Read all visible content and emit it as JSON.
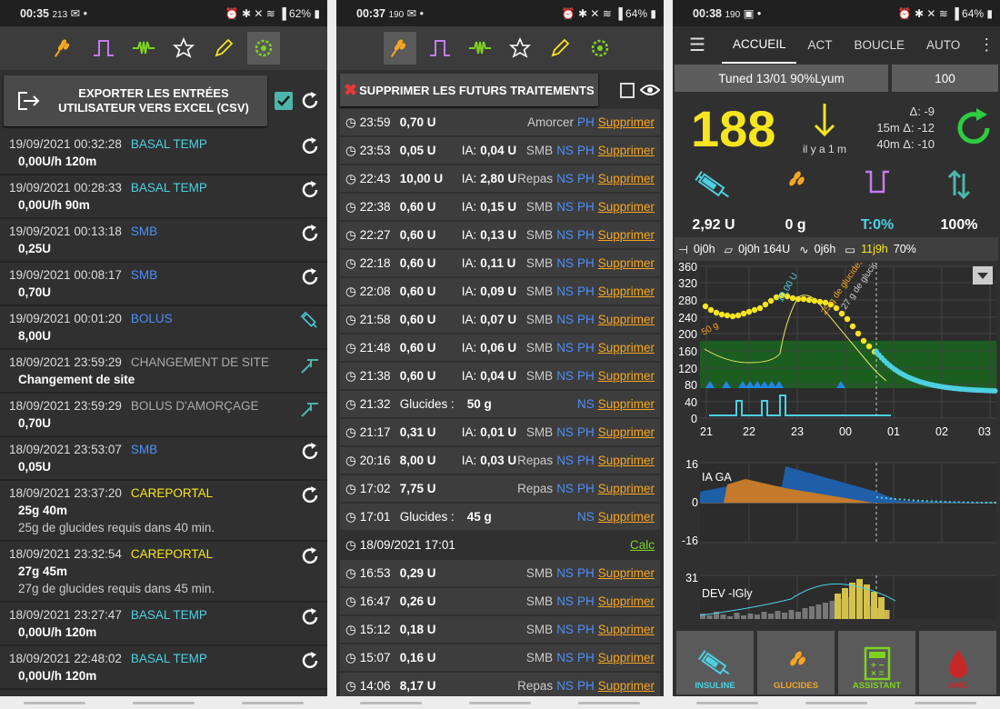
{
  "panel1": {
    "status": {
      "time": "00:35",
      "icons_left": "213",
      "battery": "62%"
    },
    "export_label": "EXPORTER LES ENTRÉES UTILISATEUR VERS EXCEL (CSV)",
    "entries": [
      {
        "date": "19/09/2021 00:32:28",
        "type": "BASAL TEMP",
        "type_color": "#4dd0e1",
        "value": "0,00U/h  120m",
        "icon": "sync-icon"
      },
      {
        "date": "19/09/2021 00:28:33",
        "type": "BASAL TEMP",
        "type_color": "#4dd0e1",
        "value": "0,00U/h  90m",
        "icon": "sync-icon"
      },
      {
        "date": "19/09/2021 00:13:18",
        "type": "SMB",
        "type_color": "#4f8ff7",
        "value": "0,25U",
        "icon": "sync-icon"
      },
      {
        "date": "19/09/2021 00:08:17",
        "type": "SMB",
        "type_color": "#4f8ff7",
        "value": "0,70U",
        "icon": "sync-icon"
      },
      {
        "date": "19/09/2021 00:01:20",
        "type": "BOLUS",
        "type_color": "#4f8ff7",
        "value": "8,00U",
        "icon": "syringe-icon"
      },
      {
        "date": "18/09/2021 23:59:29",
        "type": "CHANGEMENT DE SITE",
        "type_color": "#aaaaaa",
        "value": "Changement de site",
        "icon": "cannula-icon"
      },
      {
        "date": "18/09/2021 23:59:29",
        "type": "BOLUS D'AMORÇAGE",
        "type_color": "#aaaaaa",
        "value": "0,70U",
        "icon": "cannula-icon"
      },
      {
        "date": "18/09/2021 23:53:07",
        "type": "SMB",
        "type_color": "#4f8ff7",
        "value": "0,05U",
        "icon": "sync-icon"
      },
      {
        "date": "18/09/2021 23:37:20",
        "type": "CAREPORTAL",
        "type_color": "#f7e51f",
        "value": "25g  40m",
        "note": "25g de glucides requis dans 40 min.",
        "icon": "sync-icon"
      },
      {
        "date": "18/09/2021 23:32:54",
        "type": "CAREPORTAL",
        "type_color": "#f7e51f",
        "value": "27g  45m",
        "note": "27g de glucides requis dans 45 min.",
        "icon": "sync-icon"
      },
      {
        "date": "18/09/2021 23:27:47",
        "type": "BASAL TEMP",
        "type_color": "#4dd0e1",
        "value": "0,00U/h  120m",
        "icon": "sync-icon"
      },
      {
        "date": "18/09/2021 22:48:02",
        "type": "BASAL TEMP",
        "type_color": "#4dd0e1",
        "value": "0,00U/h  120m",
        "icon": "sync-icon"
      }
    ]
  },
  "panel2": {
    "status": {
      "time": "00:37",
      "icons_left": "190",
      "battery": "64%"
    },
    "delete_label": "SUPPRIMER LES FUTURS TRAITEMENTS",
    "rows": [
      {
        "time": "23:59",
        "amount": "0,70 U",
        "ia_label": "",
        "ia": "",
        "type": "Amorcer",
        "ns": "",
        "ph": "PH",
        "action": "Supprimer"
      },
      {
        "time": "23:53",
        "amount": "0,05 U",
        "ia_label": "IA:",
        "ia": "0,04 U",
        "type": "SMB",
        "ns": "NS",
        "ph": "PH",
        "action": "Supprimer"
      },
      {
        "time": "22:43",
        "amount": "10,00 U",
        "ia_label": "IA:",
        "ia": "2,80 U",
        "type": "Repas",
        "ns": "NS",
        "ph": "PH",
        "action": "Supprimer"
      },
      {
        "time": "22:38",
        "amount": "0,60 U",
        "ia_label": "IA:",
        "ia": "0,15 U",
        "type": "SMB",
        "ns": "NS",
        "ph": "PH",
        "action": "Supprimer"
      },
      {
        "time": "22:27",
        "amount": "0,60 U",
        "ia_label": "IA:",
        "ia": "0,13 U",
        "type": "SMB",
        "ns": "NS",
        "ph": "PH",
        "action": "Supprimer"
      },
      {
        "time": "22:18",
        "amount": "0,60 U",
        "ia_label": "IA:",
        "ia": "0,11 U",
        "type": "SMB",
        "ns": "NS",
        "ph": "PH",
        "action": "Supprimer"
      },
      {
        "time": "22:08",
        "amount": "0,60 U",
        "ia_label": "IA:",
        "ia": "0,09 U",
        "type": "SMB",
        "ns": "NS",
        "ph": "PH",
        "action": "Supprimer"
      },
      {
        "time": "21:58",
        "amount": "0,60 U",
        "ia_label": "IA:",
        "ia": "0,07 U",
        "type": "SMB",
        "ns": "NS",
        "ph": "PH",
        "action": "Supprimer"
      },
      {
        "time": "21:48",
        "amount": "0,60 U",
        "ia_label": "IA:",
        "ia": "0,06 U",
        "type": "SMB",
        "ns": "NS",
        "ph": "PH",
        "action": "Supprimer"
      },
      {
        "time": "21:38",
        "amount": "0,60 U",
        "ia_label": "IA:",
        "ia": "0,04 U",
        "type": "SMB",
        "ns": "NS",
        "ph": "PH",
        "action": "Supprimer"
      },
      {
        "time": "21:32",
        "amount": "Glucides :",
        "ia_label": "",
        "ia": "50 g",
        "type": "",
        "ns": "NS",
        "ph": "",
        "action": "Supprimer"
      },
      {
        "time": "21:17",
        "amount": "0,31 U",
        "ia_label": "IA:",
        "ia": "0,01 U",
        "type": "SMB",
        "ns": "NS",
        "ph": "PH",
        "action": "Supprimer"
      },
      {
        "time": "20:16",
        "amount": "8,00 U",
        "ia_label": "IA:",
        "ia": "0,03 U",
        "type": "Repas",
        "ns": "NS",
        "ph": "PH",
        "action": "Supprimer"
      },
      {
        "time": "17:02",
        "amount": "7,75 U",
        "ia_label": "",
        "ia": "",
        "type": "Repas",
        "ns": "NS",
        "ph": "PH",
        "action": "Supprimer"
      },
      {
        "time": "17:01",
        "amount": "Glucides :",
        "ia_label": "",
        "ia": "45 g",
        "type": "",
        "ns": "NS",
        "ph": "",
        "action": "Supprimer"
      },
      {
        "header": true,
        "time": "18/09/2021 17:01",
        "action": "Calc"
      },
      {
        "time": "16:53",
        "amount": "0,29 U",
        "ia_label": "",
        "ia": "",
        "type": "SMB",
        "ns": "NS",
        "ph": "PH",
        "action": "Supprimer"
      },
      {
        "time": "16:47",
        "amount": "0,26 U",
        "ia_label": "",
        "ia": "",
        "type": "SMB",
        "ns": "NS",
        "ph": "PH",
        "action": "Supprimer"
      },
      {
        "time": "15:12",
        "amount": "0,18 U",
        "ia_label": "",
        "ia": "",
        "type": "SMB",
        "ns": "NS",
        "ph": "PH",
        "action": "Supprimer"
      },
      {
        "time": "15:07",
        "amount": "0,16 U",
        "ia_label": "",
        "ia": "",
        "type": "SMB",
        "ns": "NS",
        "ph": "PH",
        "action": "Supprimer"
      },
      {
        "time": "14:06",
        "amount": "8,17 U",
        "ia_label": "",
        "ia": "",
        "type": "Repas",
        "ns": "NS",
        "ph": "PH",
        "action": "Supprimer"
      }
    ]
  },
  "panel3": {
    "status": {
      "time": "00:38",
      "icons_left": "190",
      "battery": "64%"
    },
    "tabs": [
      "ACCUEIL",
      "ACT",
      "BOUCLE",
      "AUTO"
    ],
    "profile": "Tuned 13/01 90%Lyum",
    "target": "100",
    "bg": "188",
    "ago": "il y a 1 m",
    "delta": "Δ:  -9",
    "delta15": "15m Δ: -12",
    "delta40": "40m Δ: -10",
    "iob": "2,92 U",
    "cob": "0 g",
    "basal": "T:0%",
    "autosens": "100%",
    "pump_cannula": "0j0h",
    "pump_reservoir": "0j0h  164U",
    "pump_sensor": "0j6h",
    "pump_battery_age": "11j9h",
    "pump_battery": "70%",
    "chart_main": {
      "y_ticks": [
        "360",
        "320",
        "280",
        "240",
        "200",
        "160",
        "120",
        "80",
        "40",
        "0"
      ],
      "x_ticks": [
        "21",
        "22",
        "23",
        "00",
        "01",
        "02",
        "03"
      ],
      "labels": {
        "carb50": "50 g",
        "bolus10": "10,00 U",
        "carb25": "25 g de glucides",
        "carb27": "27 g de glucides"
      }
    },
    "chart_ia": {
      "ymax": "16",
      "zero": "0",
      "ymin": "-16",
      "label": "IA GA"
    },
    "chart_dev": {
      "ymax": "31",
      "label": "DEV -IGly"
    },
    "buttons": [
      "INSULINE",
      "GLUCIDES",
      "ASSISTANT",
      "AMC"
    ],
    "colors": {
      "bg": "#f7e51f",
      "inrange": "#2e7d32",
      "prediction": "#4dd0e1",
      "accent": "#f7e51f"
    }
  }
}
